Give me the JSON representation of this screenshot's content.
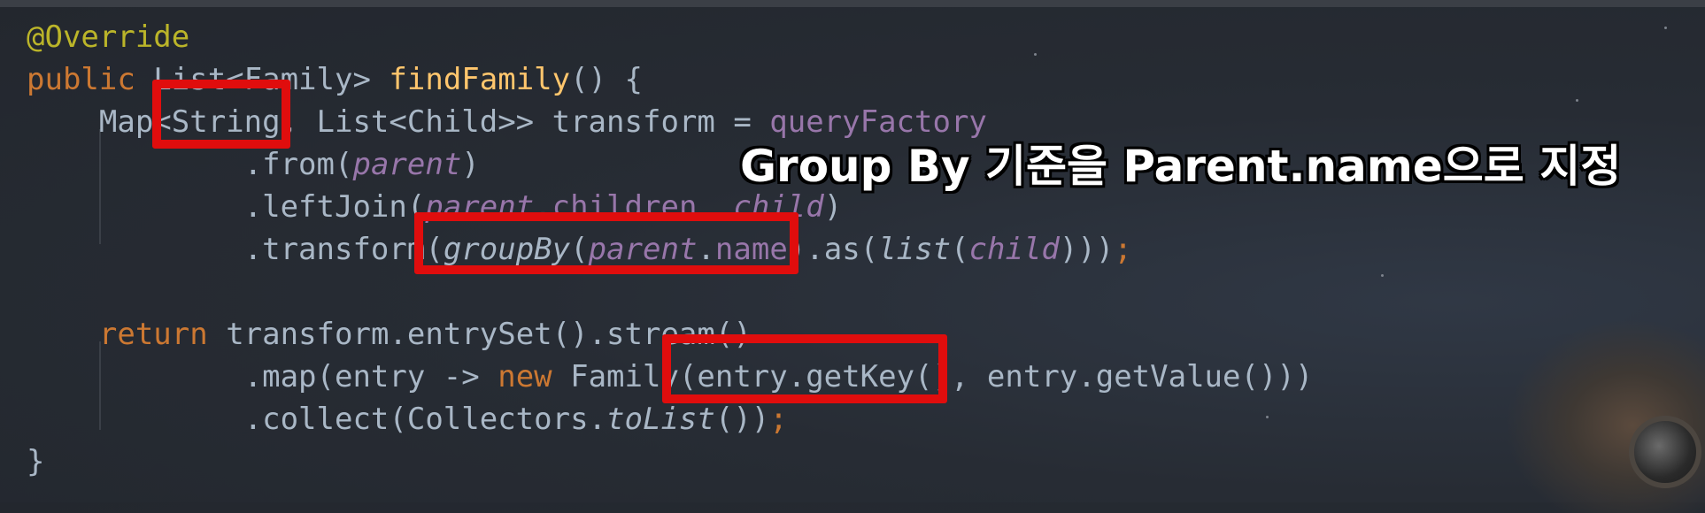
{
  "code_lines": [
    [
      {
        "t": "@Override",
        "c": "ann"
      }
    ],
    [
      {
        "t": "public",
        "c": "kw"
      },
      {
        "t": " List<Family> ",
        "c": "txt"
      },
      {
        "t": "findFamily",
        "c": "fn"
      },
      {
        "t": "() {",
        "c": "txt"
      }
    ],
    [
      {
        "t": "    Map<String, List<Child>> transform = ",
        "c": "txt"
      },
      {
        "t": "queryFactory",
        "c": "fld"
      }
    ],
    [
      {
        "t": "            .from(",
        "c": "txt"
      },
      {
        "t": "parent",
        "c": "fld it"
      },
      {
        "t": ")",
        "c": "txt"
      }
    ],
    [
      {
        "t": "            .leftJoin(",
        "c": "txt"
      },
      {
        "t": "parent",
        "c": "fld it"
      },
      {
        "t": ".",
        "c": "txt"
      },
      {
        "t": "children",
        "c": "fld"
      },
      {
        "t": ", ",
        "c": "txt"
      },
      {
        "t": "child",
        "c": "fld it"
      },
      {
        "t": ")",
        "c": "txt"
      }
    ],
    [
      {
        "t": "            .transform(",
        "c": "txt"
      },
      {
        "t": "groupBy",
        "c": "txt it"
      },
      {
        "t": "(",
        "c": "txt"
      },
      {
        "t": "parent",
        "c": "fld it"
      },
      {
        "t": ".",
        "c": "txt"
      },
      {
        "t": "name",
        "c": "fld"
      },
      {
        "t": ").as(",
        "c": "txt"
      },
      {
        "t": "list",
        "c": "txt it"
      },
      {
        "t": "(",
        "c": "txt"
      },
      {
        "t": "child",
        "c": "fld it"
      },
      {
        "t": ")))",
        "c": "txt"
      },
      {
        "t": ";",
        "c": "kw"
      }
    ],
    [],
    [
      {
        "t": "    ",
        "c": "txt"
      },
      {
        "t": "return",
        "c": "kw"
      },
      {
        "t": " transform.entrySet().stream()",
        "c": "txt"
      }
    ],
    [
      {
        "t": "            .map(entry -> ",
        "c": "txt"
      },
      {
        "t": "new",
        "c": "kw"
      },
      {
        "t": " Family(entry.getKey(), entry.getValue()))",
        "c": "txt"
      }
    ],
    [
      {
        "t": "            .collect(Collectors.",
        "c": "txt"
      },
      {
        "t": "toList",
        "c": "txt it"
      },
      {
        "t": "())",
        "c": "txt"
      },
      {
        "t": ";",
        "c": "kw"
      }
    ],
    [
      {
        "t": "}",
        "c": "txt"
      }
    ]
  ],
  "caption": "Group By 기준을 Parent.name으로 지정",
  "highlight_color": "#e00d0d",
  "syntax_colors": {
    "annotation": "#bbb529",
    "keyword": "#cc7832",
    "method": "#ffc66d",
    "field": "#9876aa",
    "text": "#a9b7c6",
    "background": "#2b2f36"
  }
}
